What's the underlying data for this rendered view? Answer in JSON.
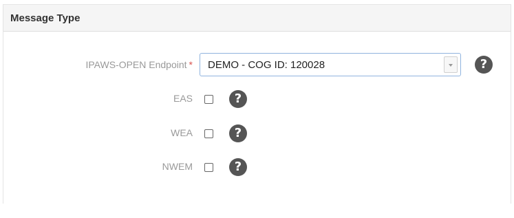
{
  "panel": {
    "title": "Message Type"
  },
  "endpoint": {
    "label": "IPAWS-OPEN Endpoint",
    "required_marker": "*",
    "selected_value": "DEMO - COG ID: 120028",
    "help_icon": "question-circle-icon"
  },
  "options": [
    {
      "label": "EAS",
      "checked": false,
      "help_icon": "question-circle-icon"
    },
    {
      "label": "WEA",
      "checked": false,
      "help_icon": "question-circle-icon"
    },
    {
      "label": "NWEM",
      "checked": false,
      "help_icon": "question-circle-icon"
    }
  ],
  "colors": {
    "required": "#d9534f",
    "heading_bg": "#f5f5f5",
    "select_border": "#8fb3de",
    "icon": "#555555"
  }
}
